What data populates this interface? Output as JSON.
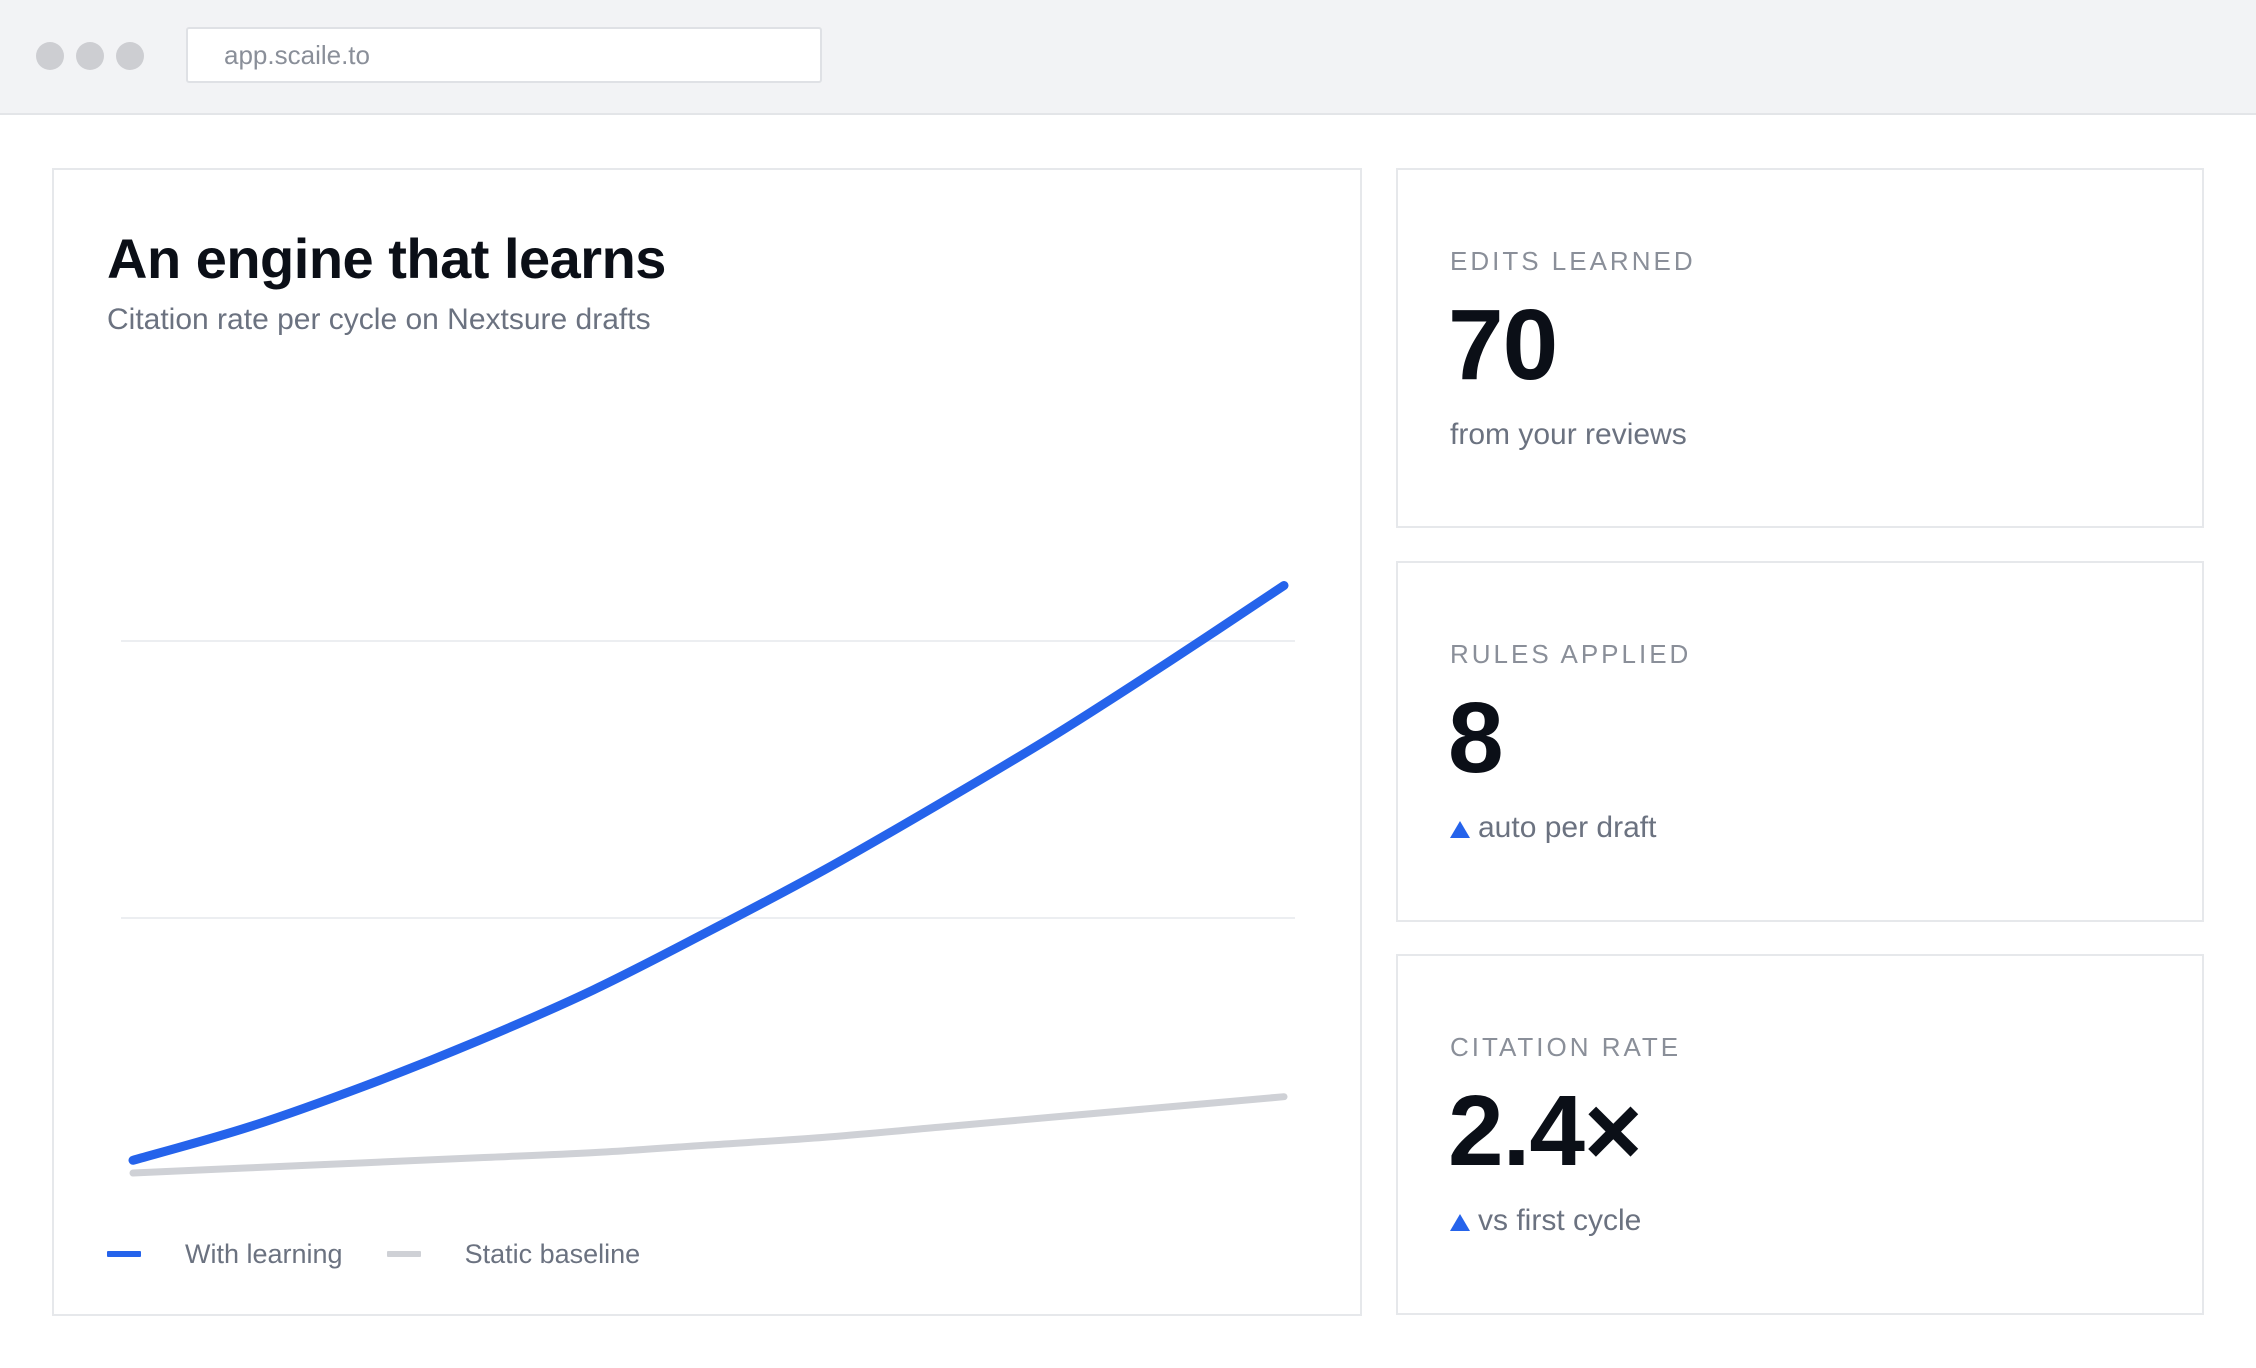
{
  "browser": {
    "url": "app.scaile.to"
  },
  "chart_card": {
    "title": "An engine that learns",
    "subtitle": "Citation rate per cycle on Nextsure drafts"
  },
  "colors": {
    "accent": "#2563eb",
    "baseline": "#cfd1d6",
    "gridline": "#eceef1"
  },
  "chart_data": {
    "type": "line",
    "title": "An engine that learns",
    "subtitle": "Citation rate per cycle on Nextsure drafts",
    "xlabel": "",
    "ylabel": "",
    "x": [
      0,
      1,
      2,
      3,
      4,
      5,
      6,
      7,
      8,
      9,
      10
    ],
    "ylim": [
      0,
      3
    ],
    "grid": true,
    "legend": "bottom-left",
    "series": [
      {
        "name": "With learning",
        "color": "#2563eb",
        "values": [
          0.05,
          0.18,
          0.34,
          0.52,
          0.72,
          0.95,
          1.19,
          1.45,
          1.72,
          2.01,
          2.31
        ]
      },
      {
        "name": "Static baseline",
        "color": "#cfd1d6",
        "values": [
          0.0,
          0.02,
          0.04,
          0.06,
          0.08,
          0.11,
          0.14,
          0.18,
          0.22,
          0.26,
          0.3
        ]
      }
    ]
  },
  "stats": [
    {
      "label": "EDITS LEARNED",
      "value": "70",
      "note": "from your reviews",
      "trend": ""
    },
    {
      "label": "RULES APPLIED",
      "value": "8",
      "note": "auto per draft",
      "trend": "up"
    },
    {
      "label": "CITATION RATE",
      "value": "2.4×",
      "note": "vs first cycle",
      "trend": "up"
    }
  ]
}
